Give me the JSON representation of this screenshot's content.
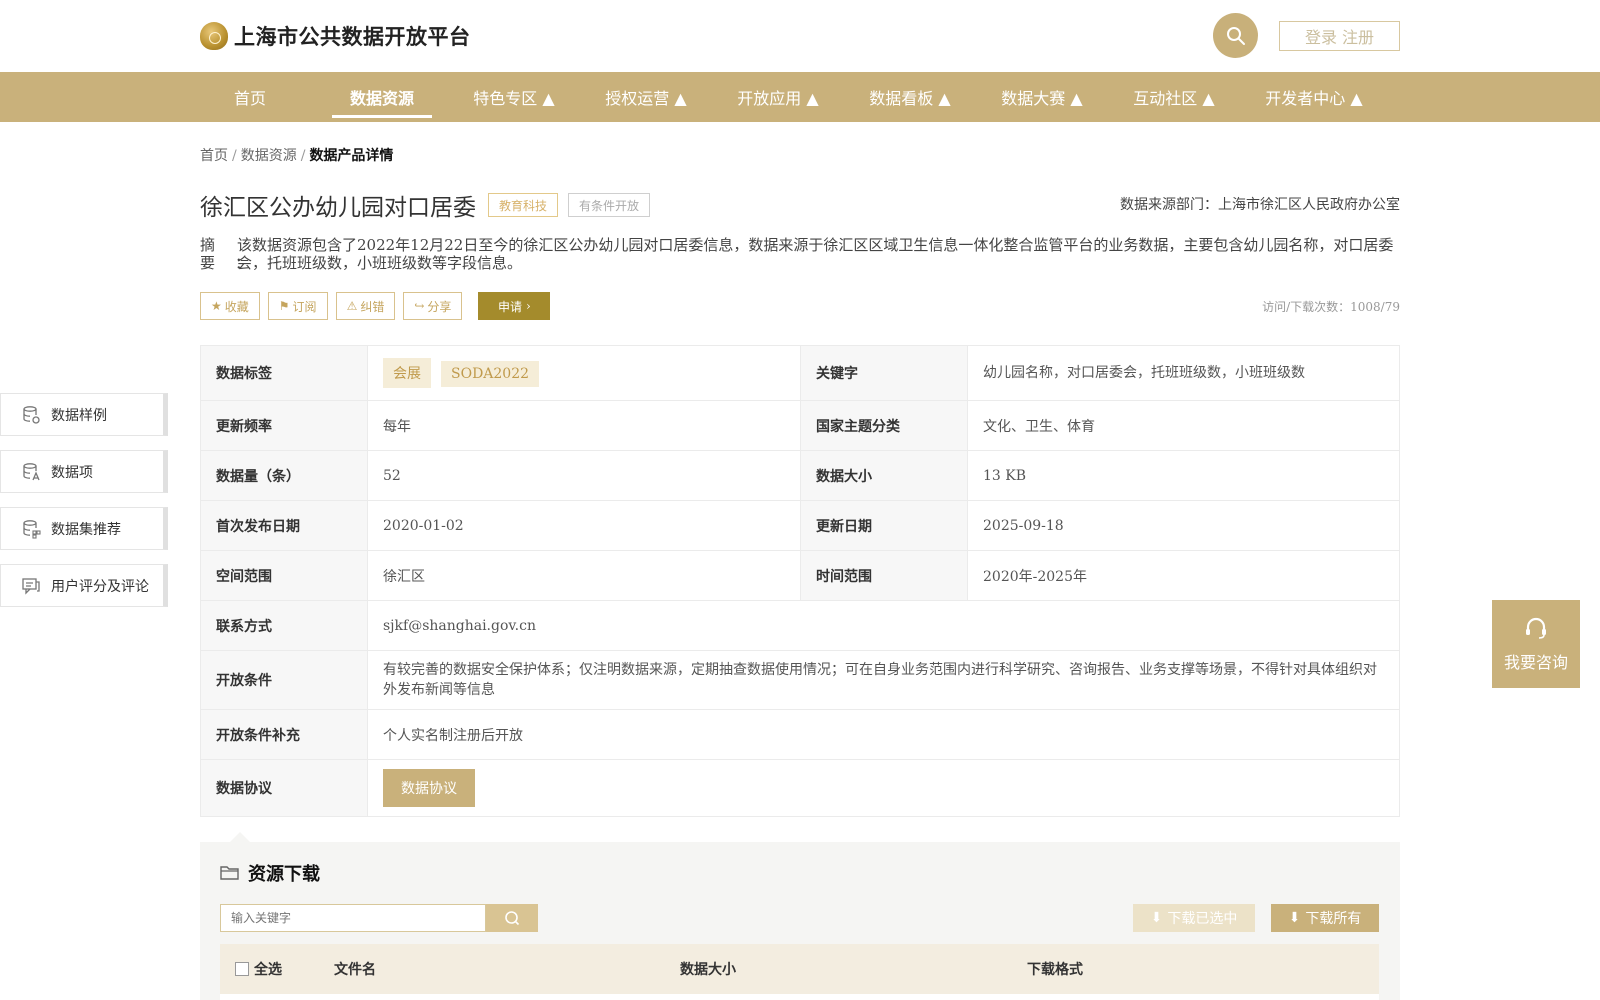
{
  "header": {
    "logo_text": "上海市公共数据开放平台",
    "login_label": "登录 注册",
    "search_icon": "search-icon"
  },
  "nav": {
    "items": [
      {
        "label": "首页"
      },
      {
        "label": "数据资源",
        "active": true
      },
      {
        "label": "特色专区 ▲"
      },
      {
        "label": "授权运营 ▲"
      },
      {
        "label": "开放应用 ▲"
      },
      {
        "label": "数据看板 ▲"
      },
      {
        "label": "数据大赛 ▲"
      },
      {
        "label": "互动社区 ▲"
      },
      {
        "label": "开发者中心 ▲"
      }
    ]
  },
  "breadcrumb": {
    "home": "首页",
    "sep": "/",
    "section": "数据资源",
    "current": "数据产品详情"
  },
  "product": {
    "title": "徐汇区公办幼儿园对口居委",
    "tag_category": "教育科技",
    "tag_open": "有条件开放",
    "source_dept": "数据来源部门：上海市徐汇区人民政府办公室",
    "summary_label": "摘要：",
    "summary_text": "该数据资源包含了2022年12月22日至今的徐汇区公办幼儿园对口居委信息，数据来源于徐汇区区域卫生信息一体化整合监管平台的业务数据，主要包含幼儿园名称，对口居委会，托班班级数，小班班级数等字段信息。"
  },
  "actions": {
    "favorite": "收藏",
    "subscribe": "订阅",
    "correct": "纠错",
    "share": "分享",
    "apply": "申请",
    "visits": "访问/下载次数：1008/79"
  },
  "sidenav": {
    "items": [
      {
        "label": "数据样例",
        "icon": "database-icon"
      },
      {
        "label": "数据项",
        "icon": "data-field-icon"
      },
      {
        "label": "数据集推荐",
        "icon": "dataset-recommend-icon"
      },
      {
        "label": "用户评分及评论",
        "icon": "comment-icon"
      }
    ]
  },
  "info": {
    "tags_label": "数据标签",
    "tags": [
      "会展",
      "SODA2022"
    ],
    "keywords_label": "关键字",
    "keywords": "幼儿园名称，对口居委会，托班班级数，小班班级数",
    "freq_label": "更新频率",
    "freq": "每年",
    "theme_label": "国家主题分类",
    "theme": "文化、卫生、体育",
    "count_label": "数据量（条）",
    "count": "52",
    "size_label": "数据大小",
    "size": "13 KB",
    "first_pub_label": "首次发布日期",
    "first_pub": "2020-01-02",
    "updated_label": "更新日期",
    "updated": "2025-09-18",
    "space_label": "空间范围",
    "space": "徐汇区",
    "time_label": "时间范围",
    "time": "2020年-2025年",
    "contact_label": "联系方式",
    "contact": "sjkf@shanghai.gov.cn",
    "cond_label": "开放条件",
    "cond": "有较完善的数据安全保护体系；仅注明数据来源，定期抽查数据使用情况；可在自身业务范围内进行科学研究、咨询报告、业务支撑等场景，不得针对具体组织对外发布新闻等信息",
    "cond_extra_label": "开放条件补充",
    "cond_extra": "个人实名制注册后开放",
    "protocol_label": "数据协议",
    "protocol_button": "数据协议"
  },
  "consult": {
    "label": "我要咨询"
  },
  "download": {
    "title": "资源下载",
    "search_placeholder": "输入关键字",
    "download_selected": "下载已选中",
    "download_all": "下载所有",
    "col_select_all": "全选",
    "col_filename": "文件名",
    "col_size": "数据大小",
    "col_format": "下载格式"
  },
  "colors": {
    "accent": "#c9b17b",
    "apply": "#a48b2c",
    "tag_chip_bg": "#f5edd8"
  }
}
